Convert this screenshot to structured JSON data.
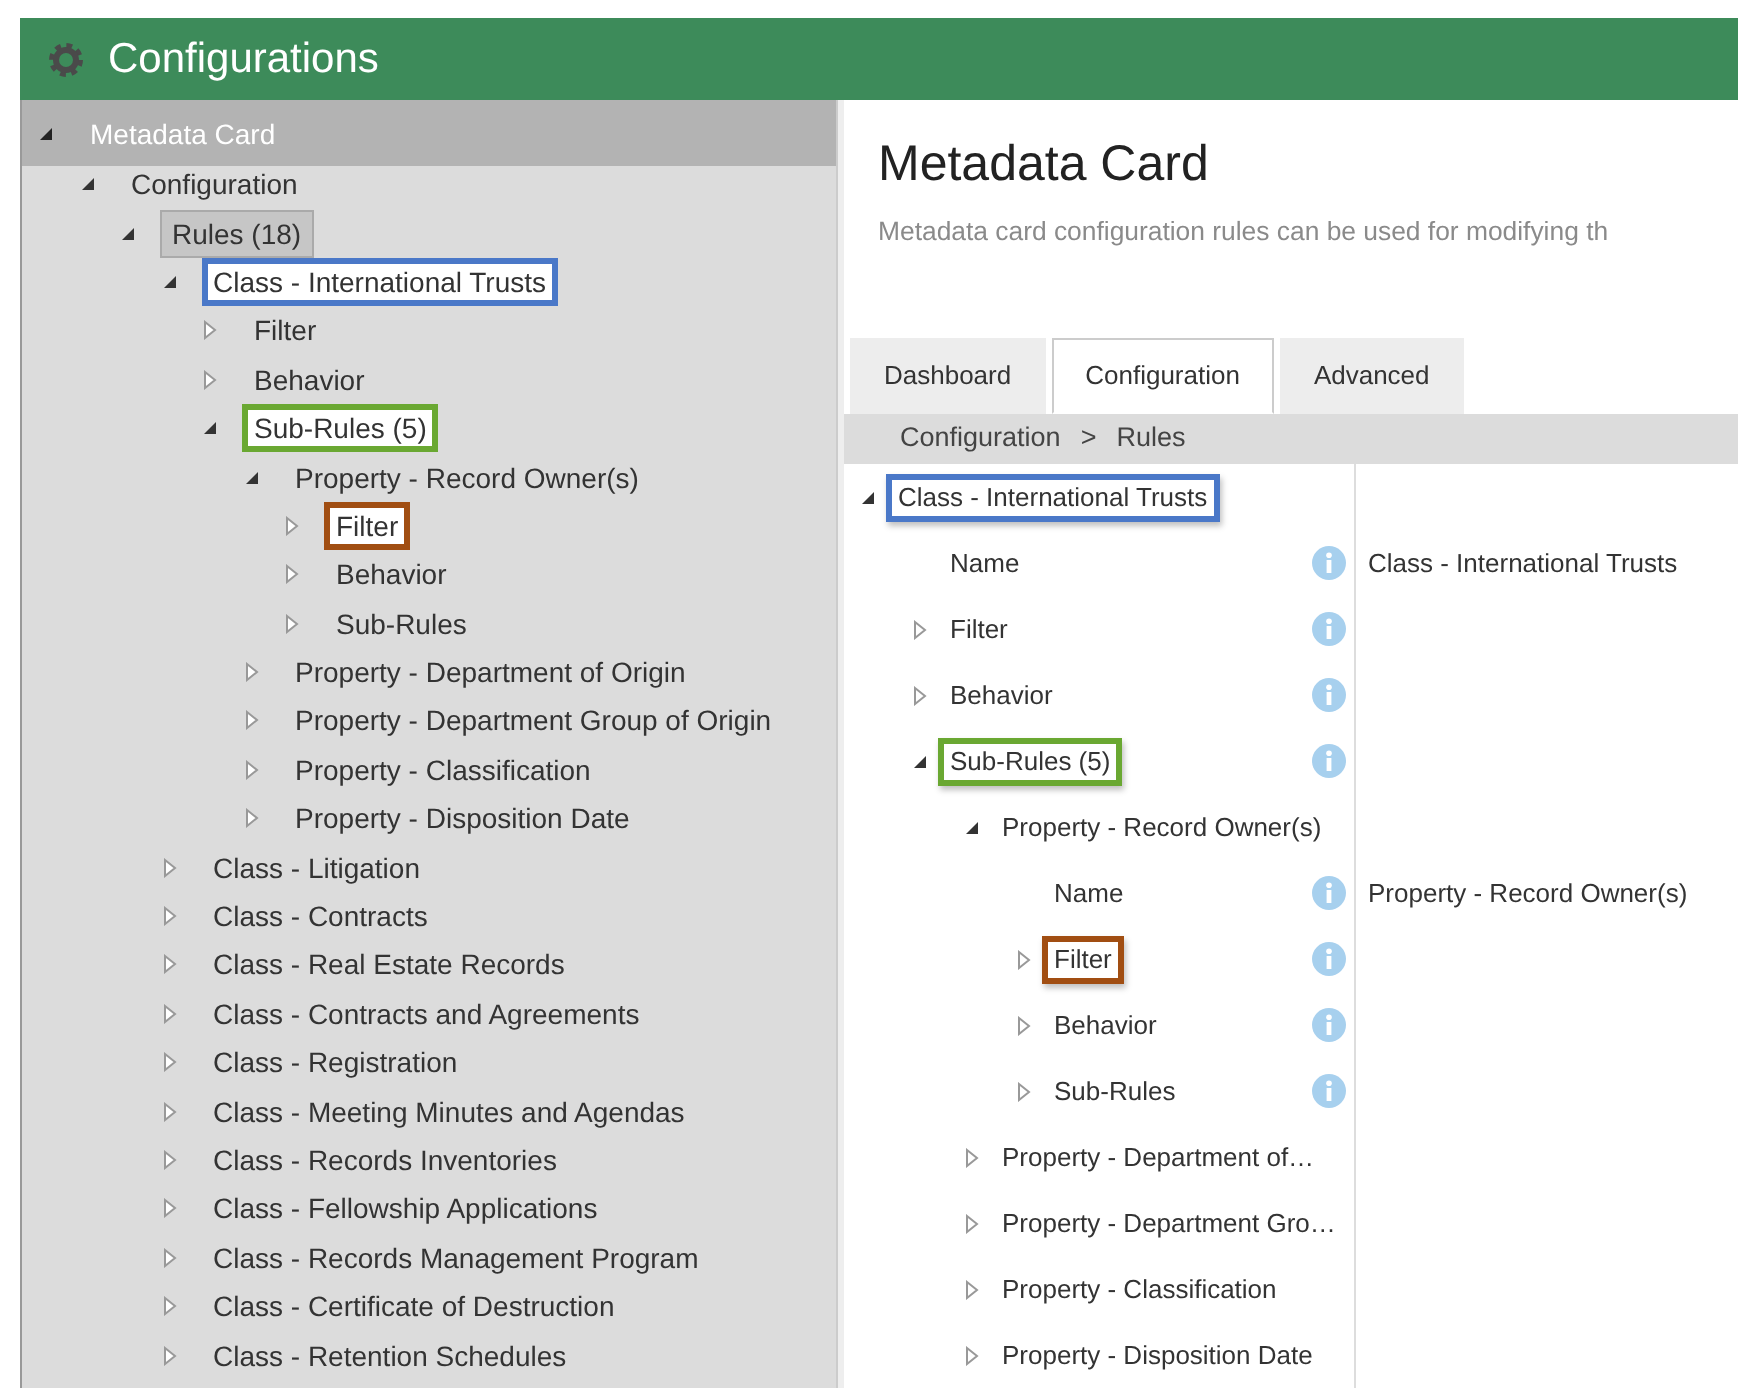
{
  "window": {
    "title": "Configurations"
  },
  "sidebar": {
    "tree": [
      {
        "label": "Metadata Card",
        "expanded": true,
        "selected": false,
        "children": [
          {
            "label": "Configuration",
            "expanded": true,
            "selected": false,
            "children": [
              {
                "label": "Rules (18)",
                "expanded": true,
                "selected": true,
                "children": [
                  {
                    "label": "Class - International Trusts",
                    "expanded": true,
                    "selected": false,
                    "color": "#4a78c8",
                    "children": [
                      {
                        "label": "Filter",
                        "expanded": false,
                        "selected": false
                      },
                      {
                        "label": "Behavior",
                        "expanded": false,
                        "selected": false
                      },
                      {
                        "label": "Sub-Rules (5)",
                        "expanded": true,
                        "selected": false,
                        "color": "#6aa832",
                        "children": [
                          {
                            "label": "Property - Record Owner(s)",
                            "expanded": true,
                            "selected": false,
                            "children": [
                              {
                                "label": "Filter",
                                "expanded": false,
                                "selected": false,
                                "color": "#a14e12"
                              },
                              {
                                "label": "Behavior",
                                "expanded": false,
                                "selected": false
                              },
                              {
                                "label": "Sub-Rules",
                                "expanded": false,
                                "selected": false
                              }
                            ]
                          },
                          {
                            "label": "Property - Department of Origin",
                            "expanded": false,
                            "selected": false
                          },
                          {
                            "label": "Property - Department Group of Origin",
                            "expanded": false,
                            "selected": false
                          },
                          {
                            "label": "Property - Classification",
                            "expanded": false,
                            "selected": false
                          },
                          {
                            "label": "Property - Disposition Date",
                            "expanded": false,
                            "selected": false
                          }
                        ]
                      }
                    ]
                  },
                  {
                    "label": "Class - Litigation",
                    "expanded": false,
                    "selected": false
                  },
                  {
                    "label": "Class - Contracts",
                    "expanded": false,
                    "selected": false
                  },
                  {
                    "label": "Class - Real Estate Records",
                    "expanded": false,
                    "selected": false
                  },
                  {
                    "label": "Class - Contracts and Agreements",
                    "expanded": false,
                    "selected": false
                  },
                  {
                    "label": "Class - Registration",
                    "expanded": false,
                    "selected": false
                  },
                  {
                    "label": "Class - Meeting Minutes and Agendas",
                    "expanded": false,
                    "selected": false
                  },
                  {
                    "label": "Class - Records Inventories",
                    "expanded": false,
                    "selected": false
                  },
                  {
                    "label": "Class - Fellowship Applications",
                    "expanded": false,
                    "selected": false
                  },
                  {
                    "label": "Class - Records Management Program",
                    "expanded": false,
                    "selected": false
                  },
                  {
                    "label": "Class - Certificate of Destruction",
                    "expanded": false,
                    "selected": false
                  },
                  {
                    "label": "Class - Retention Schedules",
                    "expanded": false,
                    "selected": false
                  }
                ]
              }
            ]
          }
        ]
      }
    ]
  },
  "content": {
    "title": "Metadata Card",
    "description": "Metadata card configuration rules can be used for modifying th",
    "tabs": [
      {
        "label": "Dashboard",
        "selected": false
      },
      {
        "label": "Configuration",
        "selected": true
      },
      {
        "label": "Advanced",
        "selected": false
      }
    ],
    "breadcrumb": {
      "items": [
        "Configuration",
        "Rules"
      ],
      "separator": ">"
    },
    "tree": [
      {
        "kind": "node",
        "label": "Class - International Trusts",
        "expanded": true,
        "info": false,
        "color": "#4a78c8",
        "children": [
          {
            "kind": "field",
            "label": "Name",
            "info": true,
            "value": "Class - International Trusts"
          },
          {
            "kind": "node",
            "label": "Filter",
            "expanded": false,
            "info": true
          },
          {
            "kind": "node",
            "label": "Behavior",
            "expanded": false,
            "info": true
          },
          {
            "kind": "node",
            "label": "Sub-Rules (5)",
            "expanded": true,
            "info": true,
            "color": "#6aa832",
            "children": [
              {
                "kind": "node",
                "label": "Property - Record Owner(s)",
                "expanded": true,
                "info": false,
                "children": [
                  {
                    "kind": "field",
                    "label": "Name",
                    "info": true,
                    "value": "Property - Record Owner(s)"
                  },
                  {
                    "kind": "node",
                    "label": "Filter",
                    "expanded": false,
                    "info": true,
                    "color": "#a14e12"
                  },
                  {
                    "kind": "node",
                    "label": "Behavior",
                    "expanded": false,
                    "info": true
                  },
                  {
                    "kind": "node",
                    "label": "Sub-Rules",
                    "expanded": false,
                    "info": true
                  }
                ]
              },
              {
                "kind": "node",
                "label": "Property - Department of…",
                "expanded": false,
                "info": false
              },
              {
                "kind": "node",
                "label": "Property - Department Gro…",
                "expanded": false,
                "info": false
              },
              {
                "kind": "node",
                "label": "Property - Classification",
                "expanded": false,
                "info": false
              },
              {
                "kind": "node",
                "label": "Property - Disposition Date",
                "expanded": false,
                "info": false
              }
            ]
          }
        ]
      }
    ]
  }
}
